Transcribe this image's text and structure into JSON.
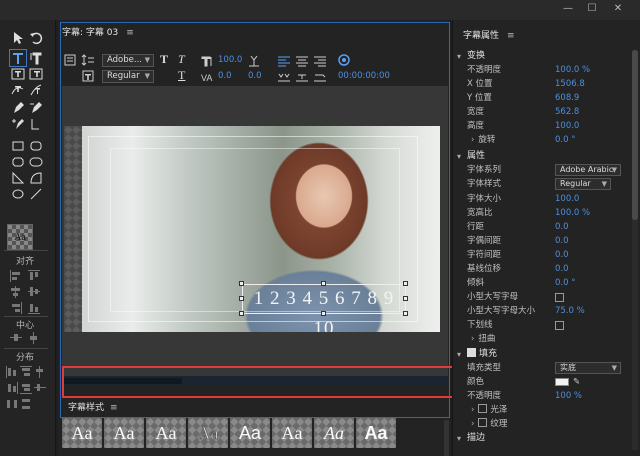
{
  "window": {
    "controls": [
      "—",
      "☐",
      "✕"
    ]
  },
  "toolbar": {
    "align_label": "对齐",
    "center_label": "中心",
    "distribute_label": "分布",
    "style_swatch_label": "Aa"
  },
  "caption_panel": {
    "tab_title": "字幕: 字幕 03",
    "font_family": "Adobe...",
    "font_style": "Regular",
    "font_size": "100.0",
    "kerning": "0.0",
    "leading": "0.0",
    "timecode": "00:00:00:00",
    "subtitle_text": "1 2 3 4 5 6 7 8 9 10",
    "progress_fraction": 0.31
  },
  "styles_panel": {
    "title": "字幕样式",
    "swatches": [
      "Aa",
      "Aa",
      "Aa",
      "Aa",
      "Aa",
      "Aa",
      "Aa",
      "Aa"
    ]
  },
  "properties_panel": {
    "title": "字幕属性",
    "transform": {
      "label": "变换",
      "rows": [
        {
          "label": "不透明度",
          "value": "100.0 %"
        },
        {
          "label": "X 位置",
          "value": "1506.8"
        },
        {
          "label": "Y 位置",
          "value": "608.9"
        },
        {
          "label": "宽度",
          "value": "562.8"
        },
        {
          "label": "高度",
          "value": "100.0"
        }
      ],
      "rotation": {
        "label": "旋转",
        "value": "0.0 °"
      }
    },
    "attributes": {
      "label": "属性",
      "font_family": {
        "label": "字体系列",
        "value": "Adobe Arabic"
      },
      "font_style": {
        "label": "字体样式",
        "value": "Regular"
      },
      "rows": [
        {
          "label": "字体大小",
          "value": "100.0"
        },
        {
          "label": "宽高比",
          "value": "100.0 %"
        },
        {
          "label": "行距",
          "value": "0.0"
        },
        {
          "label": "字偶间距",
          "value": "0.0"
        },
        {
          "label": "字符间距",
          "value": "0.0"
        },
        {
          "label": "基线位移",
          "value": "0.0"
        },
        {
          "label": "倾斜",
          "value": "0.0 °"
        }
      ],
      "small_caps": {
        "label": "小型大写字母"
      },
      "small_caps_size": {
        "label": "小型大写字母大小",
        "value": "75.0 %"
      },
      "underline": {
        "label": "下划线"
      },
      "distort": {
        "label": "扭曲"
      }
    },
    "fill": {
      "label": "填充",
      "fill_type": {
        "label": "填充类型",
        "value": "实底"
      },
      "color": {
        "label": "颜色",
        "hex": "#f2f2f2"
      },
      "opacity": {
        "label": "不透明度",
        "value": "100 %"
      },
      "sheen": {
        "label": "光泽"
      },
      "texture": {
        "label": "纹理"
      }
    },
    "stroke": {
      "label": "描边"
    }
  },
  "colors": {
    "accent": "#4d8fe0",
    "highlight_frame": "#2b67b5",
    "annotation_red": "#e03a3a"
  }
}
